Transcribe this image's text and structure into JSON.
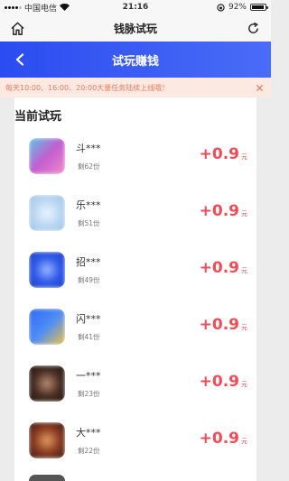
{
  "status_bar": {
    "carrier": "中国电信",
    "time": "21:16",
    "battery": "92%",
    "battery_level": 0.92
  },
  "browser": {
    "title": "钱脉试玩"
  },
  "header": {
    "title": "试玩赚钱"
  },
  "notice": {
    "text": "每天10:00、16:00、20:00大量任务陆续上线哦！"
  },
  "section": {
    "title": "当前试玩"
  },
  "apps": [
    {
      "name": "斗***",
      "remaining": "剩62份",
      "reward": "+0.9",
      "unit": "元"
    },
    {
      "name": "乐***",
      "remaining": "剩51份",
      "reward": "+0.9",
      "unit": "元"
    },
    {
      "name": "招***",
      "remaining": "剩49份",
      "reward": "+0.9",
      "unit": "元"
    },
    {
      "name": "闪***",
      "remaining": "剩41份",
      "reward": "+0.9",
      "unit": "元"
    },
    {
      "name": "一***",
      "remaining": "剩23份",
      "reward": "+0.9",
      "unit": "元"
    },
    {
      "name": "大***",
      "remaining": "剩22份",
      "reward": "+0.9",
      "unit": "元"
    }
  ],
  "colors": {
    "header": "#2b4cf0",
    "reward": "#f24b56",
    "notice_text": "#ee7b5b",
    "notice_bg": "#fbe9e2"
  },
  "icons": {
    "home": "home-icon",
    "refresh": "refresh-icon",
    "back": "back-chevron-icon",
    "close": "close-icon"
  }
}
